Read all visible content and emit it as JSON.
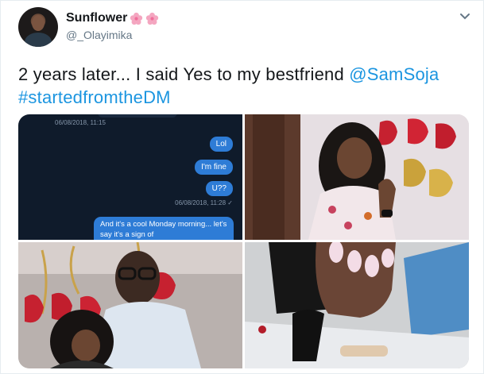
{
  "author": {
    "display_name": "Sunflower",
    "handle": "@_Olayimika"
  },
  "tweet": {
    "text_before": "2 years later... I said Yes to my bestfriend ",
    "mention": "@SamSoja",
    "hashtag": "#startedfromtheDM"
  },
  "chat": {
    "timestamp_1": "06/08/2018, 11:15",
    "messages": [
      "Lol",
      "I'm fine",
      "U??"
    ],
    "timestamp_2": "06/08/2018, 11:28 ✓",
    "long_message": "And it's a cool Monday morning... let's say it's a sign of"
  },
  "icons": {
    "flower": "cherry-blossom-icon",
    "chevron": "chevron-down-icon"
  },
  "colors": {
    "link": "#1b95e0",
    "chat_bubble": "#2e7cd6",
    "chat_bg": "#0f1b2b"
  }
}
